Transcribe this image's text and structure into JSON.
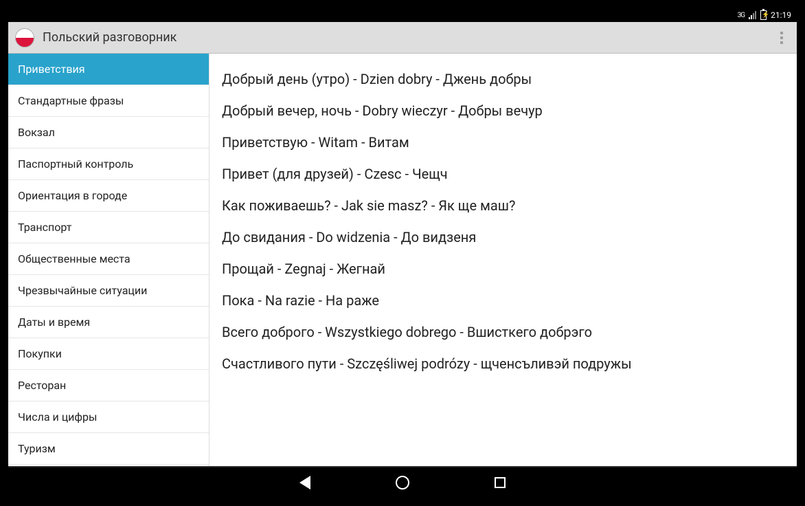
{
  "status": {
    "network": "3G",
    "time": "21:19"
  },
  "header": {
    "title": "Польский разговорник"
  },
  "sidebar": {
    "items": [
      {
        "label": "Приветствия",
        "active": true
      },
      {
        "label": "Стандартные фразы",
        "active": false
      },
      {
        "label": "Вокзал",
        "active": false
      },
      {
        "label": "Паспортный контроль",
        "active": false
      },
      {
        "label": "Ориентация в городе",
        "active": false
      },
      {
        "label": "Транспорт",
        "active": false
      },
      {
        "label": "Общественные места",
        "active": false
      },
      {
        "label": "Чрезвычайные ситуации",
        "active": false
      },
      {
        "label": "Даты и время",
        "active": false
      },
      {
        "label": "Покупки",
        "active": false
      },
      {
        "label": "Ресторан",
        "active": false
      },
      {
        "label": "Числа и цифры",
        "active": false
      },
      {
        "label": "Туризм",
        "active": false
      }
    ]
  },
  "phrases": [
    "Добрый день (утро) - Dzien dobry - Джень добры",
    "Добрый вечер, ночь - Dobry wieczyr - Добры вечур",
    "Приветствую - Witam - Витам",
    "Привет (для друзей) - Czesc - Чещч",
    "Как поживаешь? - Jak sie masz? - Як ще маш?",
    "До свидания - Do widzenia - До видзеня",
    "Прощай - Zegnaj - Жегнай",
    "Пока - Na razie - На раже",
    "Всего доброго - Wszystkiego dobrego - Вшисткего добрэго",
    "Счастливого пути - Szczęśliwej podrózy - щченсъливэй подружы"
  ]
}
